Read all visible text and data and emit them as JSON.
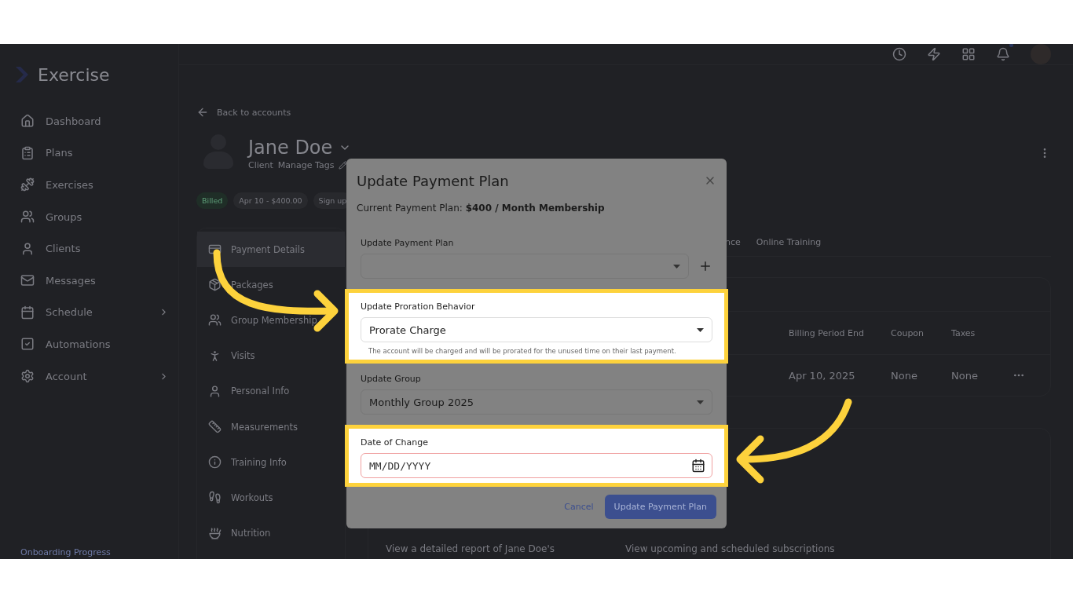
{
  "logo": {
    "text": "Exercise"
  },
  "sidebar": {
    "items": [
      {
        "label": "Dashboard",
        "expandable": false
      },
      {
        "label": "Plans",
        "expandable": false
      },
      {
        "label": "Exercises",
        "expandable": false
      },
      {
        "label": "Groups",
        "expandable": false
      },
      {
        "label": "Clients",
        "expandable": false
      },
      {
        "label": "Messages",
        "expandable": false
      },
      {
        "label": "Schedule",
        "expandable": true
      },
      {
        "label": "Automations",
        "expandable": false
      },
      {
        "label": "Account",
        "expandable": true
      }
    ],
    "footer": "Onboarding Progress"
  },
  "topbar": {
    "notification_dot": true
  },
  "back_link": "Back to accounts",
  "profile": {
    "name": "Jane Doe",
    "role": "Client",
    "tags_link": "Manage Tags"
  },
  "chips": [
    {
      "label": "Billed",
      "kind": "status"
    },
    {
      "label": "Apr 10 - $400.00",
      "kind": "plain"
    },
    {
      "label": "Sign up",
      "kind": "plain"
    }
  ],
  "account_nav": [
    {
      "label": "Payment Details",
      "selected": true
    },
    {
      "label": "Packages",
      "selected": false
    },
    {
      "label": "Group Membership",
      "selected": false
    },
    {
      "label": "Visits",
      "selected": false
    },
    {
      "label": "Personal Info",
      "selected": false
    },
    {
      "label": "Measurements",
      "selected": false
    },
    {
      "label": "Training Info",
      "selected": false
    },
    {
      "label": "Workouts",
      "selected": false
    },
    {
      "label": "Nutrition",
      "selected": false
    }
  ],
  "tabs": [
    {
      "label": "nce"
    },
    {
      "label": "Online Training"
    }
  ],
  "table": {
    "columns": [
      "Billing Period End",
      "Coupon",
      "Taxes"
    ],
    "rows": [
      [
        "Apr 10, 2025",
        "None",
        "None"
      ]
    ]
  },
  "report_links": [
    "View a detailed report of Jane Doe's",
    "View upcoming and scheduled subscriptions"
  ],
  "modal": {
    "title": "Update Payment Plan",
    "current_plan": "Current Payment Plan: **$400 / Month Membership**",
    "fields": [
      {
        "kind": "select",
        "label": "Update Payment Plan",
        "add_button": true,
        "highlighted": false,
        "error": false
      },
      {
        "kind": "select",
        "label": "Update Proration Behavior",
        "value": "Prorate Charge",
        "helper": "The account will be charged and will be prorated for the unused time on their last payment.",
        "highlighted": true,
        "error": false
      },
      {
        "kind": "select",
        "label": "Update Group",
        "value": "Monthly Group 2025",
        "highlighted": false,
        "error": false
      },
      {
        "kind": "date",
        "label": "Date of Change",
        "placeholder": "MM/DD/YYYY",
        "highlighted": true,
        "error": true
      }
    ],
    "buttons": [
      {
        "label": "Cancel",
        "kind": "text"
      },
      {
        "label": "Update Payment Plan",
        "kind": "primary"
      }
    ]
  }
}
